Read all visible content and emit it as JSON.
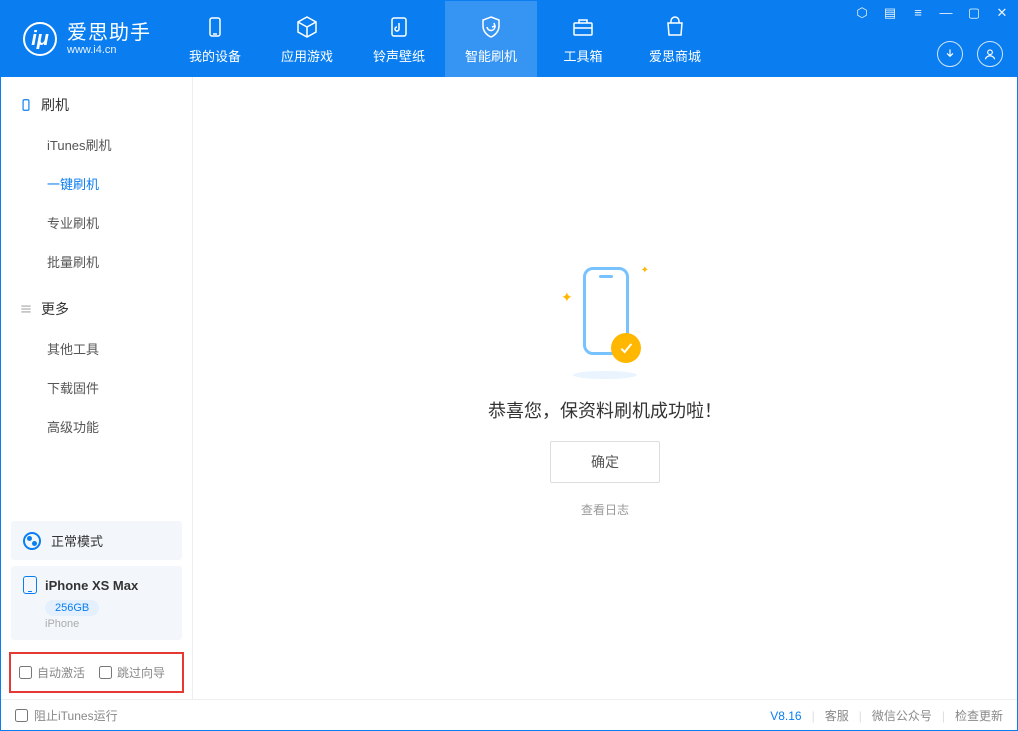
{
  "app": {
    "title": "爱思助手",
    "subtitle": "www.i4.cn",
    "logo_letter": "iμ"
  },
  "tabs": {
    "device": "我的设备",
    "apps": "应用游戏",
    "ringtone": "铃声壁纸",
    "flash": "智能刷机",
    "toolbox": "工具箱",
    "store": "爱思商城"
  },
  "sidebar": {
    "section_flash": "刷机",
    "items_flash": {
      "itunes": "iTunes刷机",
      "oneclick": "一键刷机",
      "pro": "专业刷机",
      "batch": "批量刷机"
    },
    "section_more": "更多",
    "items_more": {
      "other": "其他工具",
      "firmware": "下载固件",
      "advanced": "高级功能"
    }
  },
  "mode": {
    "label": "正常模式"
  },
  "device": {
    "name": "iPhone XS Max",
    "storage": "256GB",
    "type": "iPhone"
  },
  "checks": {
    "auto_activate": "自动激活",
    "skip_guide": "跳过向导"
  },
  "main": {
    "success": "恭喜您，保资料刷机成功啦！",
    "ok": "确定",
    "view_log": "查看日志"
  },
  "footer": {
    "block_itunes": "阻止iTunes运行",
    "version": "V8.16",
    "support": "客服",
    "wechat": "微信公众号",
    "update": "检查更新"
  }
}
